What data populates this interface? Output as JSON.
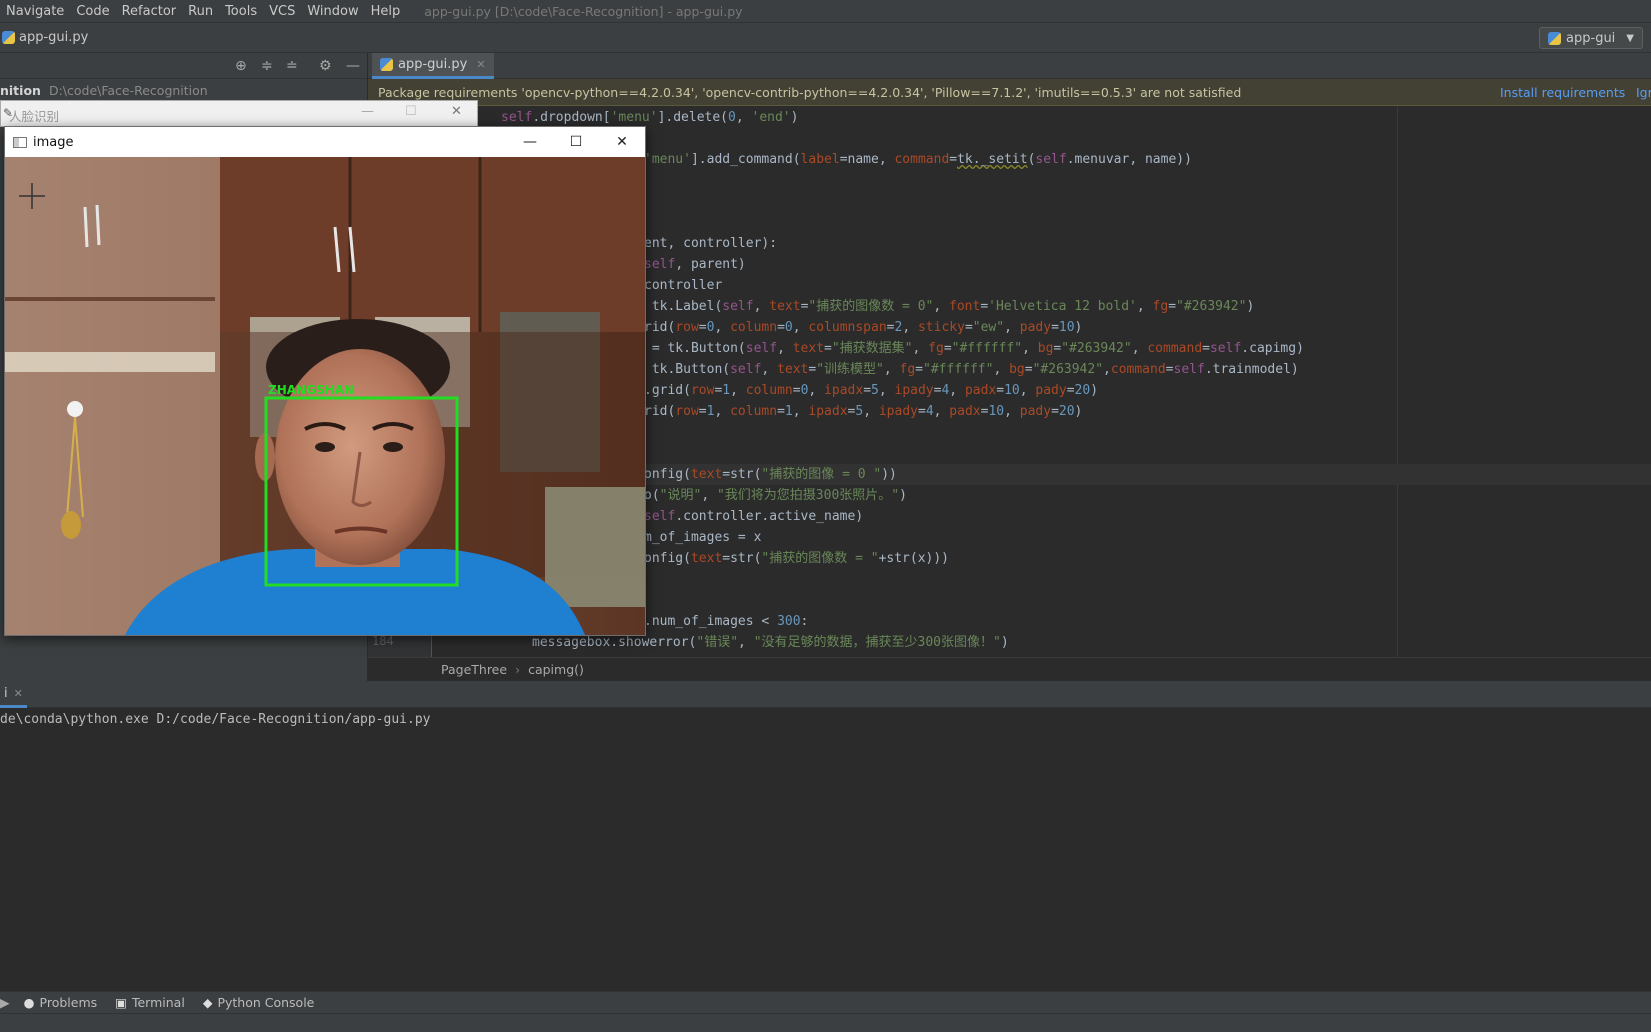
{
  "menubar": {
    "items": [
      "Navigate",
      "Code",
      "Refactor",
      "Run",
      "Tools",
      "VCS",
      "Window",
      "Help"
    ],
    "title": "app-gui.py [D:\\code\\Face-Recognition] - app-gui.py"
  },
  "navbar": {
    "file": "app-gui.py",
    "run_config": "app-gui"
  },
  "project": {
    "name": "nition",
    "path": "D:\\code\\Face-Recognition"
  },
  "editor_tab": {
    "label": "app-gui.py"
  },
  "banner": {
    "text": "Package requirements 'opencv-python==4.2.0.34', 'opencv-contrib-python==4.2.0.34', 'Pillow==7.1.2', 'imutils==0.5.3' are not satisfied",
    "install": "Install requirements",
    "ignore": "Igno"
  },
  "code": {
    "visible_line_number": "184"
  },
  "breadcrumb": {
    "class": "PageThree",
    "method": "capimg()"
  },
  "run": {
    "tab": "i",
    "output": "de\\conda\\python.exe D:/code/Face-Recognition/app-gui.py"
  },
  "bottom_tabs": {
    "problems": "Problems",
    "terminal": "Terminal",
    "console": "Python Console"
  },
  "tk_window": {
    "title": "人脸识别"
  },
  "image_window": {
    "title": "image",
    "face_label": "ZHANGSHAN"
  },
  "colors": {
    "accent": "#4a88c7",
    "face_box": "#22dd22",
    "banner_bg": "#434134"
  }
}
